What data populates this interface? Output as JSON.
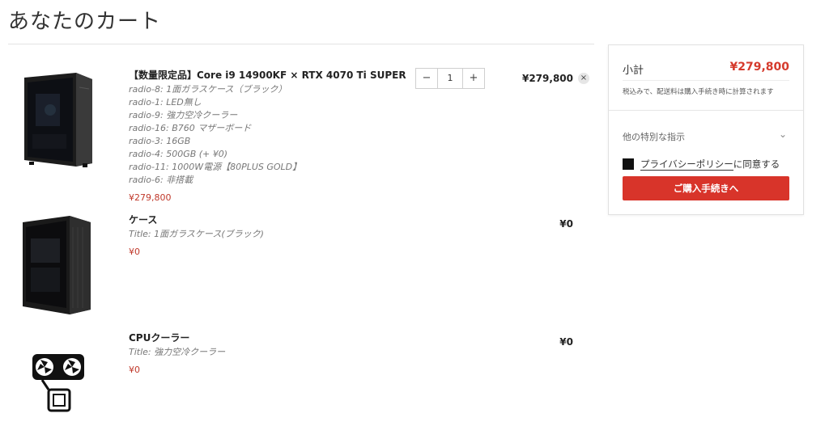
{
  "page": {
    "title": "あなたのカート"
  },
  "items": [
    {
      "name": "【数量限定品】Core i9 14900KF × RTX 4070 Ti SUPER",
      "options": [
        "radio-8: 1面ガラスケース（ブラック）",
        "radio-1: LED無し",
        "radio-9: 強力空冷クーラー",
        "radio-16: B760 マザーボード",
        "radio-3: 16GB",
        "radio-4: 500GB (+ ¥0)",
        "radio-11: 1000W電源【80PLUS GOLD】",
        "radio-6: 非搭載"
      ],
      "price": "¥279,800",
      "line_total": "¥279,800",
      "quantity": "1",
      "qty_minus": "−",
      "qty_plus": "+",
      "remove": "×"
    },
    {
      "name": "ケース",
      "options": [
        "Title: 1面ガラスケース(ブラック)"
      ],
      "price": "¥0",
      "line_total": "¥0"
    },
    {
      "name": "CPUクーラー",
      "options": [
        "Title: 強力空冷クーラー"
      ],
      "price": "¥0",
      "line_total": "¥0"
    }
  ],
  "summary": {
    "subtotal_label": "小計",
    "subtotal_value": "¥279,800",
    "tax_note": "税込みで、配送料は購入手続き時に計算されます",
    "instructions_label": "他の特別な指示",
    "chevron": "⌄",
    "privacy_link": "プライバシーポリシー",
    "privacy_suffix": "に同意する",
    "checkout_label": "ご購入手続きへ"
  },
  "colors": {
    "accent": "#d8342a",
    "price_red": "#c0392b"
  }
}
